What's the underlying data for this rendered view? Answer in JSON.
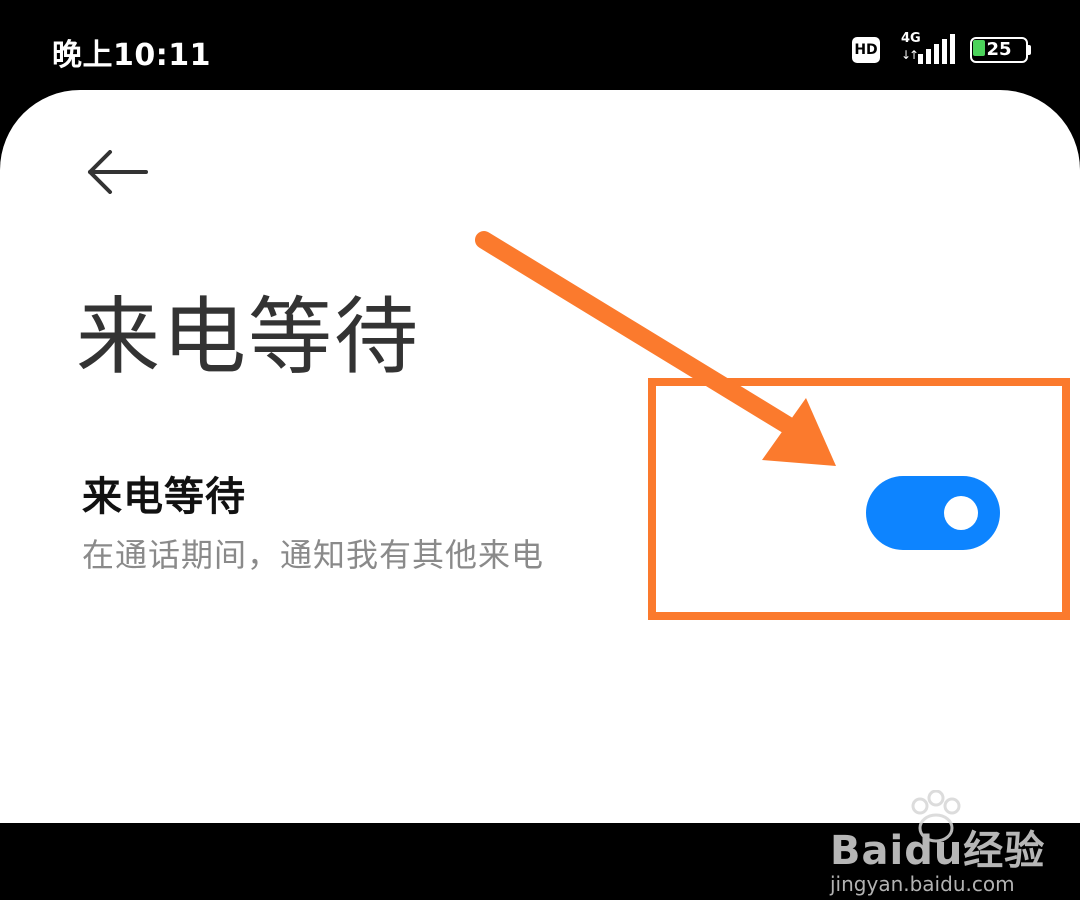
{
  "status_bar": {
    "time": "晚上10:11",
    "hd_badge": "HD",
    "network_type": "4G",
    "network_arrows": "↓↑",
    "battery_level": "25",
    "battery_fill_fraction": 0.25,
    "battery_color": "#4cd35b"
  },
  "header": {
    "back_icon": "arrow-left-icon",
    "title": "来电等待"
  },
  "setting": {
    "label": "来电等待",
    "description": "在通话期间，通知我有其他来电",
    "toggle_on": true,
    "toggle_color": "#0d84ff"
  },
  "annotation": {
    "color": "#fb7a2d",
    "shape": "arrow-and-box"
  },
  "watermark": {
    "brand": "Baidu经验",
    "url": "jingyan.baidu.com"
  }
}
